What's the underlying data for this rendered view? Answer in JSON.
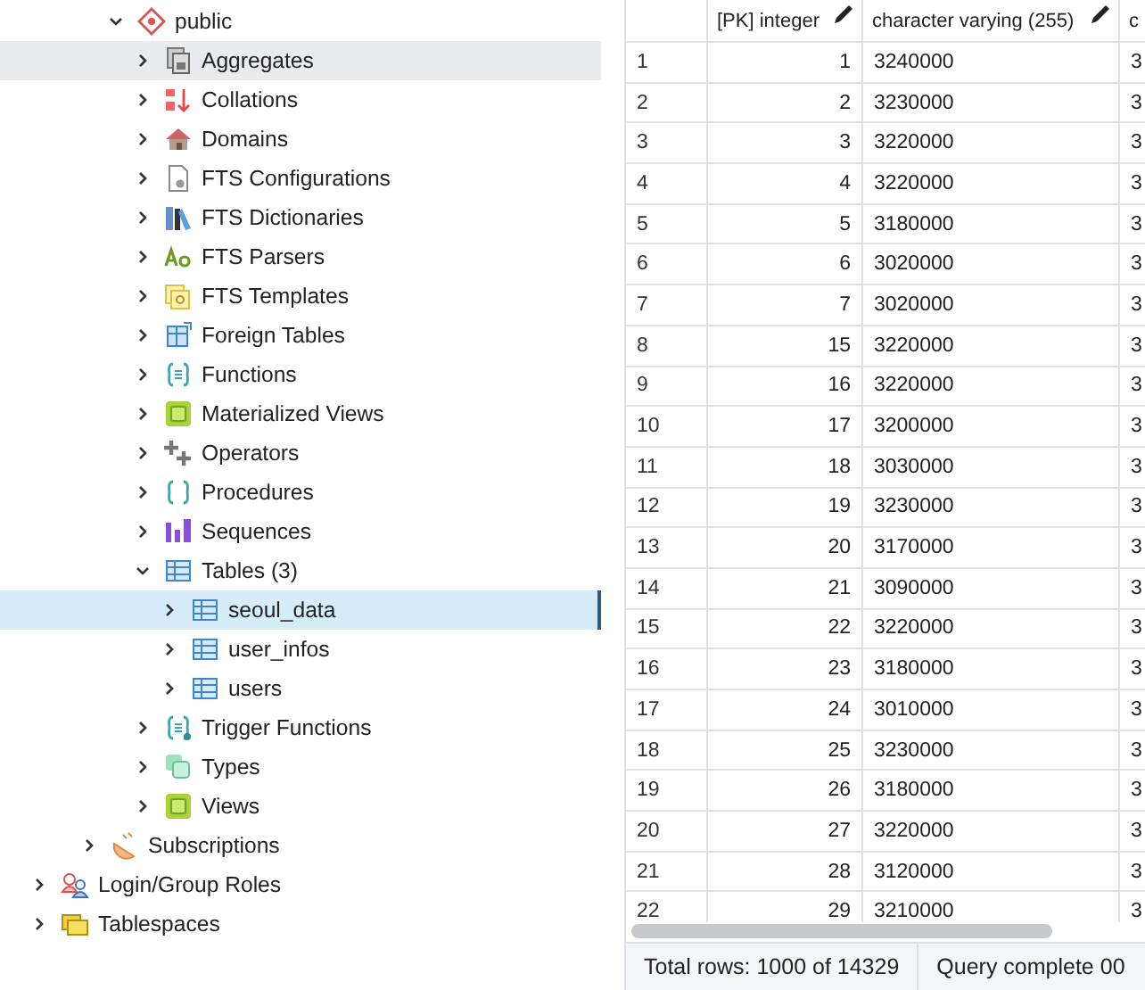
{
  "tree": [
    {
      "children": [
        {
          "children": [
            {
              "label": "public",
              "kind": "schema",
              "expanded": true,
              "selected": false,
              "hovered": false,
              "children": [
                {
                  "label": "Aggregates",
                  "kind": "aggregate",
                  "expanded": false,
                  "selected": false,
                  "hovered": true
                },
                {
                  "label": "Collations",
                  "kind": "collation",
                  "expanded": false,
                  "selected": false,
                  "hovered": false
                },
                {
                  "label": "Domains",
                  "kind": "domain",
                  "expanded": false,
                  "selected": false,
                  "hovered": false
                },
                {
                  "label": "FTS Configurations",
                  "kind": "fts-config",
                  "expanded": false,
                  "selected": false,
                  "hovered": false
                },
                {
                  "label": "FTS Dictionaries",
                  "kind": "fts-dict",
                  "expanded": false,
                  "selected": false,
                  "hovered": false
                },
                {
                  "label": "FTS Parsers",
                  "kind": "fts-parser",
                  "expanded": false,
                  "selected": false,
                  "hovered": false
                },
                {
                  "label": "FTS Templates",
                  "kind": "fts-template",
                  "expanded": false,
                  "selected": false,
                  "hovered": false
                },
                {
                  "label": "Foreign Tables",
                  "kind": "foreign-table",
                  "expanded": false,
                  "selected": false,
                  "hovered": false
                },
                {
                  "label": "Functions",
                  "kind": "function",
                  "expanded": false,
                  "selected": false,
                  "hovered": false
                },
                {
                  "label": "Materialized Views",
                  "kind": "matview",
                  "expanded": false,
                  "selected": false,
                  "hovered": false
                },
                {
                  "label": "Operators",
                  "kind": "operator",
                  "expanded": false,
                  "selected": false,
                  "hovered": false
                },
                {
                  "label": "Procedures",
                  "kind": "procedure",
                  "expanded": false,
                  "selected": false,
                  "hovered": false
                },
                {
                  "label": "Sequences",
                  "kind": "sequence",
                  "expanded": false,
                  "selected": false,
                  "hovered": false
                },
                {
                  "label": "Tables (3)",
                  "kind": "tables",
                  "expanded": true,
                  "selected": false,
                  "hovered": false,
                  "children": [
                    {
                      "label": "seoul_data",
                      "kind": "table",
                      "expanded": false,
                      "selected": true,
                      "hovered": false
                    },
                    {
                      "label": "user_infos",
                      "kind": "table",
                      "expanded": false,
                      "selected": false,
                      "hovered": false
                    },
                    {
                      "label": "users",
                      "kind": "table",
                      "expanded": false,
                      "selected": false,
                      "hovered": false
                    }
                  ]
                },
                {
                  "label": "Trigger Functions",
                  "kind": "trigger-function",
                  "expanded": false,
                  "selected": false,
                  "hovered": false
                },
                {
                  "label": "Types",
                  "kind": "type",
                  "expanded": false,
                  "selected": false,
                  "hovered": false
                },
                {
                  "label": "Views",
                  "kind": "view",
                  "expanded": false,
                  "selected": false,
                  "hovered": false
                }
              ]
            }
          ]
        },
        {
          "label": "Subscriptions",
          "kind": "subscription",
          "expanded": false,
          "selected": false,
          "hovered": false
        }
      ]
    },
    {
      "label": "Login/Group Roles",
      "kind": "role",
      "expanded": false,
      "selected": false,
      "hovered": false
    },
    {
      "label": "Tablespaces",
      "kind": "tablespace",
      "expanded": false,
      "selected": false,
      "hovered": false
    }
  ],
  "grid": {
    "columns": [
      {
        "header": "[PK] integer",
        "editable": true
      },
      {
        "header": "character varying (255)",
        "editable": true
      },
      {
        "header": "c"
      }
    ],
    "rows": [
      {
        "number": "1",
        "cells": [
          "1",
          "3240000",
          "3"
        ]
      },
      {
        "number": "2",
        "cells": [
          "2",
          "3230000",
          "3"
        ]
      },
      {
        "number": "3",
        "cells": [
          "3",
          "3220000",
          "3"
        ]
      },
      {
        "number": "4",
        "cells": [
          "4",
          "3220000",
          "3"
        ]
      },
      {
        "number": "5",
        "cells": [
          "5",
          "3180000",
          "3"
        ]
      },
      {
        "number": "6",
        "cells": [
          "6",
          "3020000",
          "3"
        ]
      },
      {
        "number": "7",
        "cells": [
          "7",
          "3020000",
          "3"
        ]
      },
      {
        "number": "8",
        "cells": [
          "15",
          "3220000",
          "3"
        ]
      },
      {
        "number": "9",
        "cells": [
          "16",
          "3220000",
          "3"
        ]
      },
      {
        "number": "10",
        "cells": [
          "17",
          "3200000",
          "3"
        ]
      },
      {
        "number": "11",
        "cells": [
          "18",
          "3030000",
          "3"
        ]
      },
      {
        "number": "12",
        "cells": [
          "19",
          "3230000",
          "3"
        ]
      },
      {
        "number": "13",
        "cells": [
          "20",
          "3170000",
          "3"
        ]
      },
      {
        "number": "14",
        "cells": [
          "21",
          "3090000",
          "3"
        ]
      },
      {
        "number": "15",
        "cells": [
          "22",
          "3220000",
          "3"
        ]
      },
      {
        "number": "16",
        "cells": [
          "23",
          "3180000",
          "3"
        ]
      },
      {
        "number": "17",
        "cells": [
          "24",
          "3010000",
          "3"
        ]
      },
      {
        "number": "18",
        "cells": [
          "25",
          "3230000",
          "3"
        ]
      },
      {
        "number": "19",
        "cells": [
          "26",
          "3180000",
          "3"
        ]
      },
      {
        "number": "20",
        "cells": [
          "27",
          "3220000",
          "3"
        ]
      },
      {
        "number": "21",
        "cells": [
          "28",
          "3120000",
          "3"
        ]
      },
      {
        "number": "22",
        "cells": [
          "29",
          "3210000",
          "3"
        ]
      }
    ]
  },
  "status_bar": {
    "total_rows": "Total rows: 1000 of 14329",
    "query_status": "Query complete 00"
  }
}
